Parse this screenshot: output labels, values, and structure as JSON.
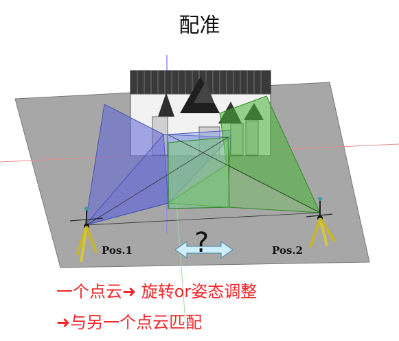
{
  "title": "配准",
  "question_mark": "?",
  "positions": [
    {
      "label": "Pos.1"
    },
    {
      "label": "Pos.2"
    }
  ],
  "captions": {
    "line1": "一个点云➜ 旋转or姿态调整",
    "line2": "➜与另一个点云匹配"
  },
  "colors": {
    "ground": "#a6a6a6",
    "frustum_1": "#6a6fd8",
    "frustum_2": "#5ec24b",
    "caption": "#f2272c",
    "arrow": "#cdeefd"
  }
}
